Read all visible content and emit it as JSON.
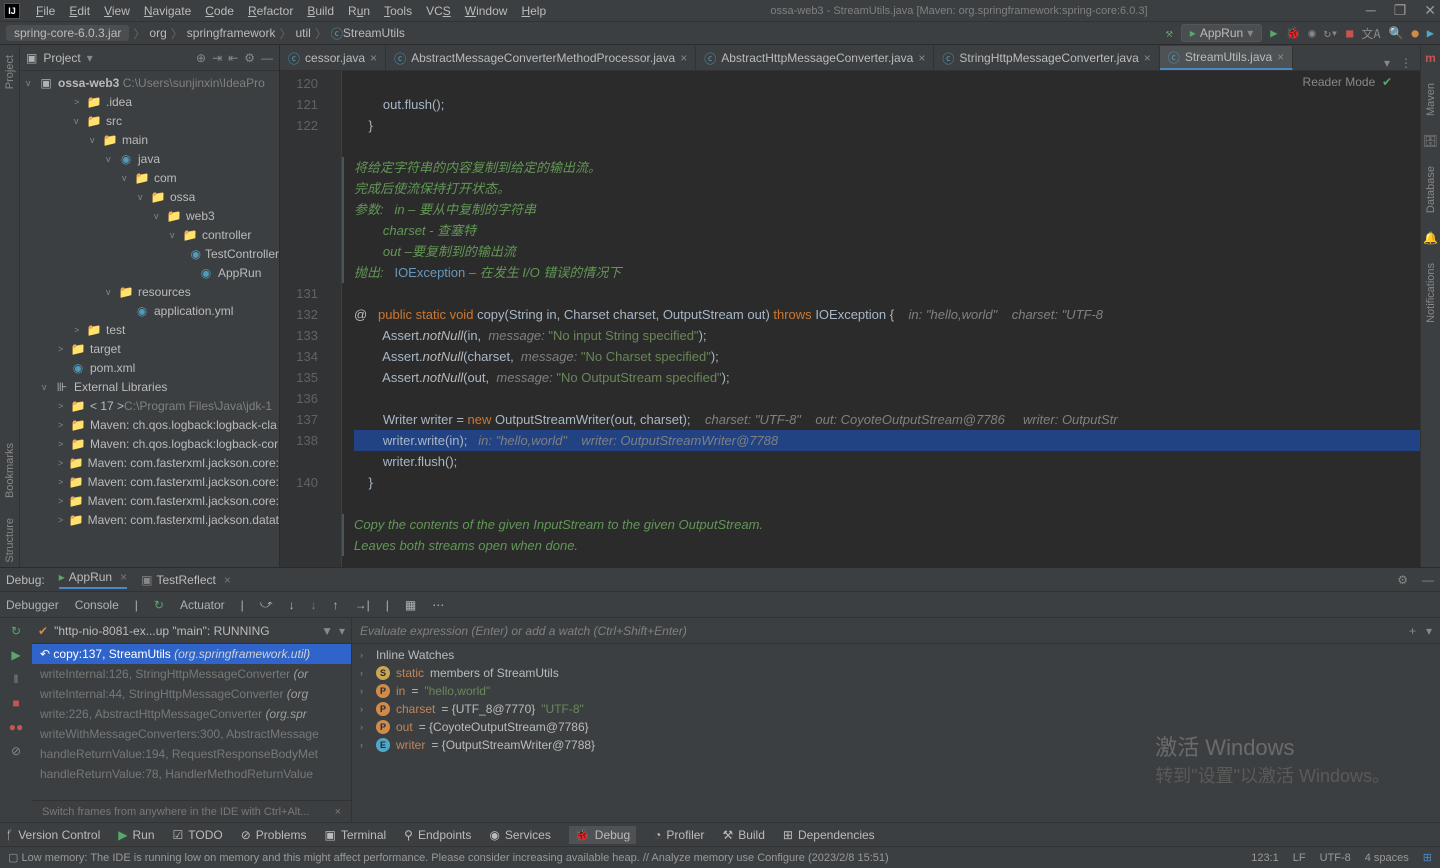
{
  "window": {
    "title": "ossa-web3 - StreamUtils.java [Maven: org.springframework:spring-core:6.0.3]",
    "menu": [
      "File",
      "Edit",
      "View",
      "Navigate",
      "Code",
      "Refactor",
      "Build",
      "Run",
      "Tools",
      "VCS",
      "Window",
      "Help"
    ]
  },
  "breadcrumb": {
    "root": "spring-core-6.0.3.jar",
    "parts": [
      "org",
      "springframework",
      "util"
    ],
    "file": "StreamUtils"
  },
  "runconfig": "AppRun",
  "project": {
    "title": "Project",
    "root": "ossa-web3",
    "rootPath": "C:\\Users\\sunjinxin\\IdeaPro",
    "nodes": [
      {
        "indent": 1,
        "arrow": ">",
        "icon": "fold",
        "label": ".idea"
      },
      {
        "indent": 1,
        "arrow": "v",
        "icon": "fold",
        "label": "src"
      },
      {
        "indent": 2,
        "arrow": "v",
        "icon": "fold",
        "label": "main"
      },
      {
        "indent": 3,
        "arrow": "v",
        "icon": "jfile",
        "label": "java"
      },
      {
        "indent": 4,
        "arrow": "v",
        "icon": "fold",
        "label": "com"
      },
      {
        "indent": 5,
        "arrow": "v",
        "icon": "fold",
        "label": "ossa"
      },
      {
        "indent": 6,
        "arrow": "v",
        "icon": "fold",
        "label": "web3"
      },
      {
        "indent": 7,
        "arrow": "v",
        "icon": "fold",
        "label": "controller"
      },
      {
        "indent": 8,
        "arrow": "",
        "icon": "jfile",
        "label": "TestController"
      },
      {
        "indent": 8,
        "arrow": "",
        "icon": "jfile",
        "label": "AppRun"
      },
      {
        "indent": 3,
        "arrow": "v",
        "icon": "fold",
        "label": "resources"
      },
      {
        "indent": 4,
        "arrow": "",
        "icon": "jfile",
        "label": "application.yml"
      },
      {
        "indent": 1,
        "arrow": ">",
        "icon": "fold",
        "label": "test"
      },
      {
        "indent": 0,
        "arrow": ">",
        "icon": "foldo",
        "label": "target"
      },
      {
        "indent": 0,
        "arrow": "",
        "icon": "jfile",
        "label": "pom.xml",
        "m": true
      },
      {
        "indent": -1,
        "arrow": "v",
        "icon": "lib",
        "label": "External Libraries"
      },
      {
        "indent": 0,
        "arrow": ">",
        "icon": "fold",
        "label": "< 17 >",
        "grey": "C:\\Program Files\\Java\\jdk-1"
      },
      {
        "indent": 0,
        "arrow": ">",
        "icon": "fold",
        "label": "Maven: ch.qos.logback:logback-cla"
      },
      {
        "indent": 0,
        "arrow": ">",
        "icon": "fold",
        "label": "Maven: ch.qos.logback:logback-cor"
      },
      {
        "indent": 0,
        "arrow": ">",
        "icon": "fold",
        "label": "Maven: com.fasterxml.jackson.core:"
      },
      {
        "indent": 0,
        "arrow": ">",
        "icon": "fold",
        "label": "Maven: com.fasterxml.jackson.core:"
      },
      {
        "indent": 0,
        "arrow": ">",
        "icon": "fold",
        "label": "Maven: com.fasterxml.jackson.core:"
      },
      {
        "indent": 0,
        "arrow": ">",
        "icon": "fold",
        "label": "Maven: com.fasterxml.jackson.datat"
      }
    ]
  },
  "tabs": [
    {
      "label": "cessor.java",
      "close": true
    },
    {
      "label": "AbstractMessageConverterMethodProcessor.java",
      "close": true
    },
    {
      "label": "AbstractHttpMessageConverter.java",
      "close": true
    },
    {
      "label": "StringHttpMessageConverter.java",
      "close": true
    },
    {
      "label": "StreamUtils.java",
      "close": true,
      "active": true
    }
  ],
  "reader_mode": "Reader Mode",
  "lines": [
    "120",
    "121",
    "122",
    "",
    "",
    "",
    "",
    "",
    "",
    "",
    "131",
    "132",
    "133",
    "134",
    "135",
    "136",
    "137",
    "138",
    "",
    "140",
    "",
    ""
  ],
  "doc": {
    "l1": "将给定字符串的内容复制到给定的输出流。",
    "l2": "完成后使流保持打开状态。",
    "l3": "参数:   in – 要从中复制的字符串",
    "l4": "charset - 查塞特",
    "l5": "out –要复制到的输出流",
    "l6": "抛出:   ",
    "l6b": "IOException",
    "l6c": " – 在发生 I/O 错误的情况下"
  },
  "code": {
    "l120": "        out.flush();",
    "l121": "    }",
    "sig_at": "@",
    "sig": "public static void copy(String in, Charset charset, OutputStream out) throws IOException {",
    "hint1": "in: \"hello,world\"    charset: \"UTF-8",
    "l132": "    Assert.notNull(in,  message: \"No input String specified\");",
    "l133": "    Assert.notNull(charset,  message: \"No Charset specified\");",
    "l134": "    Assert.notNull(out,  message: \"No OutputStream specified\");",
    "l136": "    Writer writer = new OutputStreamWriter(out, charset);",
    "hint136": "charset: \"UTF-8\"    out: CoyoteOutputStream@7786     writer: OutputStr",
    "l137": "    writer.write(in);",
    "hint137": "in: \"hello,world\"    writer: OutputStreamWriter@7788",
    "l138": "    writer.flush();",
    "l139": "}",
    "doc2a": "Copy the contents of the given InputStream to the given OutputStream.",
    "doc2b": "Leaves both streams open when done."
  },
  "debug": {
    "label": "Debug:",
    "tabs": [
      {
        "label": "AppRun",
        "active": true
      },
      {
        "label": "TestReflect"
      }
    ],
    "subtabs": [
      "Debugger",
      "Console"
    ],
    "actuator": "Actuator",
    "thread": "\"http-nio-8081-ex...up \"main\": RUNNING",
    "frames": [
      {
        "sel": true,
        "text": "copy:137, StreamUtils",
        "pkg": "(org.springframework.util)"
      },
      {
        "text": "writeInternal:126, StringHttpMessageConverter",
        "pkg": "(or"
      },
      {
        "text": "writeInternal:44, StringHttpMessageConverter",
        "pkg": "(org"
      },
      {
        "text": "write:226, AbstractHttpMessageConverter",
        "pkg": "(org.spr"
      },
      {
        "text": "writeWithMessageConverters:300, AbstractMessage",
        "pkg": ""
      },
      {
        "text": "handleReturnValue:194, RequestResponseBodyMet",
        "pkg": ""
      },
      {
        "text": "handleReturnValue:78, HandlerMethodReturnValue",
        "pkg": ""
      }
    ],
    "hint": "Switch frames from anywhere in the IDE with Ctrl+Alt...",
    "evalPlaceholder": "Evaluate expression (Enter) or add a watch (Ctrl+Shift+Enter)",
    "vars": [
      {
        "type": "text",
        "label": "Inline Watches"
      },
      {
        "type": "s",
        "name": "static",
        "val": " members of StreamUtils"
      },
      {
        "type": "p",
        "name": "in",
        "val": " = ",
        "str": "\"hello,world\""
      },
      {
        "type": "p",
        "name": "charset",
        "val": " = {UTF_8@7770} ",
        "str": "\"UTF-8\""
      },
      {
        "type": "p",
        "name": "out",
        "val": " = {CoyoteOutputStream@7786}"
      },
      {
        "type": "e",
        "name": "writer",
        "val": " = {OutputStreamWriter@7788}"
      }
    ]
  },
  "bottombar": [
    "Version Control",
    "Run",
    "TODO",
    "Problems",
    "Terminal",
    "Endpoints",
    "Services",
    "Debug",
    "Profiler",
    "Build",
    "Dependencies"
  ],
  "status": {
    "msg": "Low memory: The IDE is running low on memory and this might affect performance. Please consider increasing available heap. // Analyze memory use    Configure (2023/2/8 15:51)",
    "pos": "123:1",
    "lf": "LF",
    "enc": "UTF-8",
    "indent": "4 spaces"
  },
  "watermark": {
    "big": "激活 Windows",
    "small": "转到\"设置\"以激活 Windows。"
  },
  "rightTabs": [
    "Maven",
    "Database",
    "Notifications"
  ],
  "leftTabs": [
    "Project",
    "Bookmarks",
    "Structure"
  ]
}
